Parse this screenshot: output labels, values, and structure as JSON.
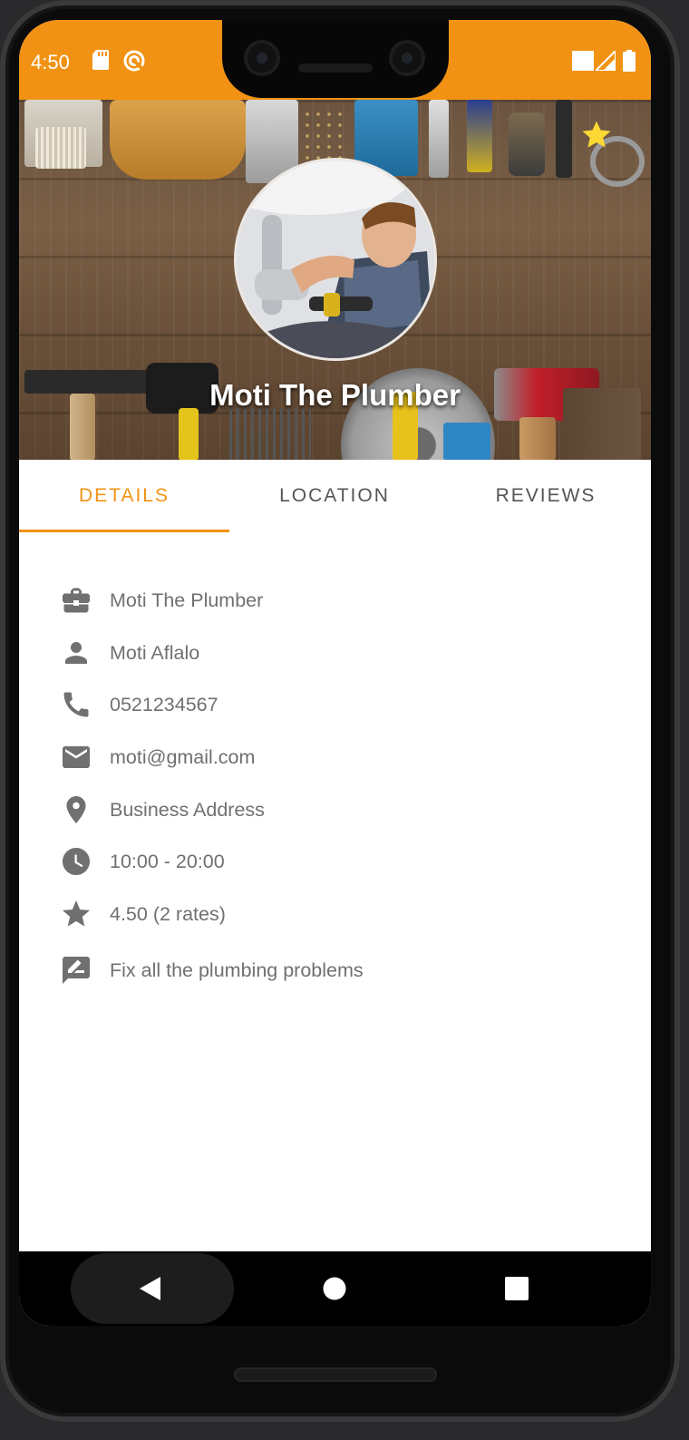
{
  "status_bar": {
    "time": "4:50"
  },
  "header": {
    "title": "Moti The Plumber",
    "favorite_color": "#fdd835"
  },
  "tabs": [
    {
      "label": "DETAILS",
      "active": true
    },
    {
      "label": "LOCATION",
      "active": false
    },
    {
      "label": "REVIEWS",
      "active": false
    }
  ],
  "details": {
    "business_name": "Moti The Plumber",
    "owner_name": "Moti Aflalo",
    "phone": "0521234567",
    "email": "moti@gmail.com",
    "address": "Business Address",
    "hours": "10:00 - 20:00",
    "rating": "4.50 (2 rates)",
    "description": "Fix all the plumbing problems"
  },
  "icons": {
    "business_name": "briefcase-icon",
    "owner_name": "person-icon",
    "phone": "phone-icon",
    "email": "email-icon",
    "address": "location-pin-icon",
    "hours": "clock-icon",
    "rating": "star-icon",
    "description": "edit-note-icon"
  },
  "colors": {
    "accent": "#f29214",
    "icon": "#707070",
    "text": "#707070",
    "tab_inactive": "#555555"
  }
}
